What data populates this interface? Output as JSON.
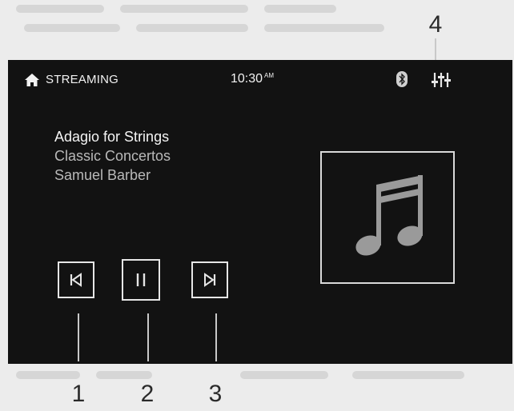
{
  "status_bar": {
    "source": "STREAMING",
    "time": "10:30",
    "am_pm": "AM",
    "icons": [
      "home-icon",
      "bluetooth-icon",
      "equalizer-icon"
    ]
  },
  "now_playing": {
    "title": "Adagio for Strings",
    "album": "Classic Concertos",
    "artist": "Samuel Barber",
    "artwork_icon": "music-note-icon"
  },
  "controls": {
    "previous_icon": "skip-previous-icon",
    "pause_icon": "pause-icon",
    "next_icon": "skip-next-icon"
  },
  "callouts": {
    "c1": "1",
    "c2": "2",
    "c3": "3",
    "c4": "4"
  },
  "colors": {
    "screen_bg": "#121212",
    "foreground": "#f2f2f2",
    "secondary_text": "#b9b9b9",
    "page_bg": "#ececec"
  }
}
